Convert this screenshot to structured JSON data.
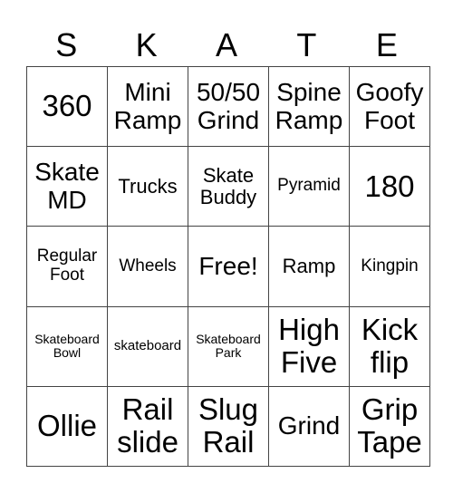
{
  "header": [
    "S",
    "K",
    "A",
    "T",
    "E"
  ],
  "rows": [
    [
      {
        "text": "360",
        "size": "s1"
      },
      {
        "text": "Mini Ramp",
        "size": "s2"
      },
      {
        "text": "50/50 Grind",
        "size": "s2"
      },
      {
        "text": "Spine Ramp",
        "size": "s2"
      },
      {
        "text": "Goofy Foot",
        "size": "s2"
      }
    ],
    [
      {
        "text": "Skate MD",
        "size": "s2"
      },
      {
        "text": "Trucks",
        "size": "s3"
      },
      {
        "text": "Skate Buddy",
        "size": "s3"
      },
      {
        "text": "Pyramid",
        "size": "s4"
      },
      {
        "text": "180",
        "size": "s1"
      }
    ],
    [
      {
        "text": "Regular Foot",
        "size": "s4"
      },
      {
        "text": "Wheels",
        "size": "s4"
      },
      {
        "text": "Free!",
        "size": "s2"
      },
      {
        "text": "Ramp",
        "size": "s3"
      },
      {
        "text": "Kingpin",
        "size": "s4"
      }
    ],
    [
      {
        "text": "Skateboard Bowl",
        "size": "s5"
      },
      {
        "text": "skateboard",
        "size": "s6"
      },
      {
        "text": "Skateboard Park",
        "size": "s5"
      },
      {
        "text": "High Five",
        "size": "s1"
      },
      {
        "text": "Kick flip",
        "size": "s1"
      }
    ],
    [
      {
        "text": "Ollie",
        "size": "s1"
      },
      {
        "text": "Rail slide",
        "size": "s1"
      },
      {
        "text": "Slug Rail",
        "size": "s1"
      },
      {
        "text": "Grind",
        "size": "s2"
      },
      {
        "text": "Grip Tape",
        "size": "s1"
      }
    ]
  ]
}
